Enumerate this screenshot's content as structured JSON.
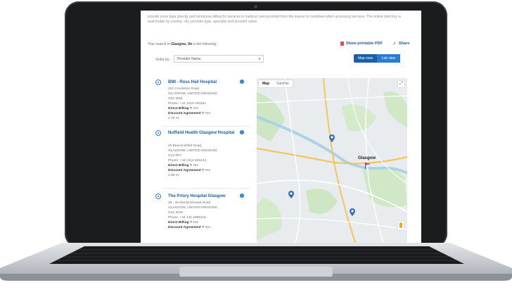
{
  "intro_text": "provide more data directly and reimburse billing for services in medical care provided from the insurer to members when accessing services. The online directory is searchable by country, city, provider type, specialty and provider name.",
  "search": {
    "prefix": "Your search in",
    "location": "Glasgow, Uk",
    "suffix": "is the following:"
  },
  "actions": {
    "pdf_label": "Show printable PDF",
    "share_label": "Share"
  },
  "order_by": {
    "label": "Order by:",
    "selected": "Provider Name"
  },
  "view_toggle": {
    "map_view": "Map view",
    "list_view": "List view",
    "active": "list_view"
  },
  "providers": [
    {
      "name": "BMI - Ross Hall Hospital",
      "address": [
        "221 Crookston Road",
        "GLASGOW, UNITED KINGDOM,",
        "G52 3NQ"
      ],
      "phone": "Phone: +44 1418 100151",
      "direct_billing_label": "Direct Billing ?",
      "direct_billing_value": "Yes",
      "discount_label": "Discount Agreement ?",
      "discount_value": "Yes",
      "distance": "4.75 mi"
    },
    {
      "name": "Nuffield Health Glasgow Hospital",
      "address": [
        "25 Beaconsfield Road,",
        "GLASGOW, UNITED KINGDOM,",
        "G12 0PJ"
      ],
      "phone": "Phone: +44 1413 345443",
      "direct_billing_label": "Direct Billing ?",
      "direct_billing_value": "Yes",
      "discount_label": "Discount Agreement ?",
      "discount_value": "Yes",
      "distance": "2.58 mi"
    },
    {
      "name": "The Priory Hospital Glasgow",
      "address": [
        "38 - 40 Mansionhouse Road",
        "GLASGOW, UNITED KINGDOM,",
        "G41 3DW"
      ],
      "phone": "Phone: +44 141 6366116",
      "direct_billing_label": "Direct Billing ?",
      "direct_billing_value": "Yes",
      "discount_label": "Discount Agreement ?",
      "discount_value": "Yes",
      "distance": ""
    }
  ],
  "map": {
    "tab_map": "Map",
    "tab_satellite": "Satellite",
    "city": "Glasgow",
    "fullscreen_icon": "fullscreen-icon",
    "pegman_icon": "pegman-icon"
  },
  "colors": {
    "link": "#1d5fa6",
    "accent": "#2b7bd6",
    "toggle_bg": "#1d5fa6"
  }
}
